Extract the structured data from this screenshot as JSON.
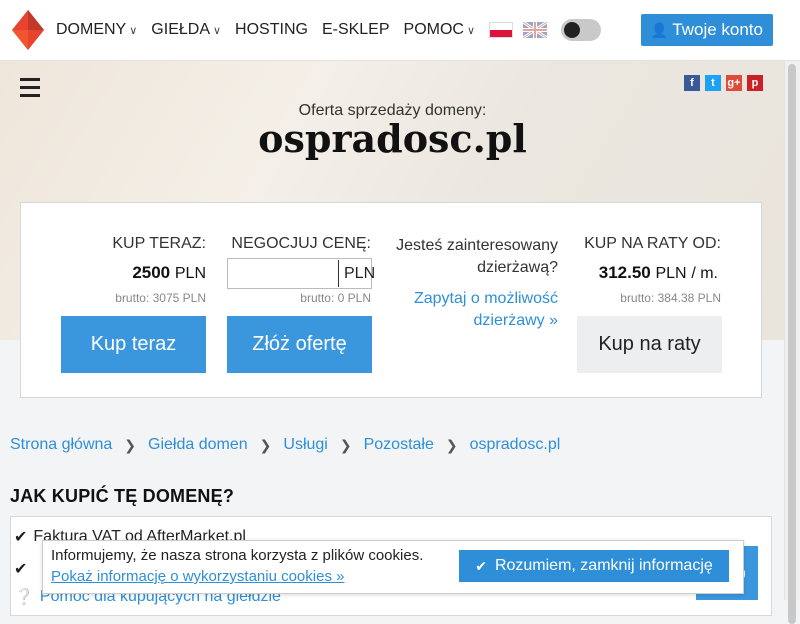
{
  "nav": {
    "items": [
      {
        "label": "DOMENY",
        "dropdown": true
      },
      {
        "label": "GIEŁDA",
        "dropdown": true
      },
      {
        "label": "HOSTING",
        "dropdown": false
      },
      {
        "label": "E-SKLEP",
        "dropdown": false
      },
      {
        "label": "POMOC",
        "dropdown": true
      }
    ],
    "account_label": "Twoje konto"
  },
  "hero": {
    "offer_label": "Oferta sprzedaży domeny:",
    "domain": "ospradosc.pl"
  },
  "purchase": {
    "buy_now": {
      "head": "KUP TERAZ:",
      "price": "2500",
      "currency": "PLN",
      "brutto": "brutto: 3075 PLN",
      "button": "Kup teraz"
    },
    "negotiate": {
      "head": "NEGOCJUJ CENĘ:",
      "input_value": "",
      "currency": "PLN",
      "brutto": "brutto: 0 PLN",
      "button": "Złóż ofertę"
    },
    "lease": {
      "question": "Jesteś zainteresowany dzierżawą?",
      "link": "Zapytaj o możliwość dzierżawy »"
    },
    "installments": {
      "head": "KUP NA RATY OD:",
      "price": "312.50",
      "currency": "PLN",
      "period": "/ m.",
      "brutto": "brutto: 384.38 PLN",
      "button": "Kup na raty"
    }
  },
  "breadcrumb": [
    "Strona główna",
    "Giełda domen",
    "Usługi",
    "Pozostałe",
    "ospradosc.pl"
  ],
  "how_to": {
    "title": "JAK KUPIĆ TĘ DOMENĘ?",
    "steps": [
      "Faktura VAT od AfterMarket.pl",
      "Pomoc dla kupujących na giełdzie"
    ]
  },
  "cookie": {
    "message": "Informujemy, że nasza strona korzysta z plików cookies.",
    "link": "Pokaż informację o wykorzystaniu cookies »",
    "button": "Rozumiem, zamknij informację"
  },
  "colors": {
    "accent": "#2e8fd8",
    "button_blue": "#3a97de",
    "logo_red": "#e8432f"
  },
  "icons": {
    "social": [
      "facebook-icon",
      "twitter-icon",
      "google-plus-icon",
      "pinterest-icon"
    ]
  }
}
